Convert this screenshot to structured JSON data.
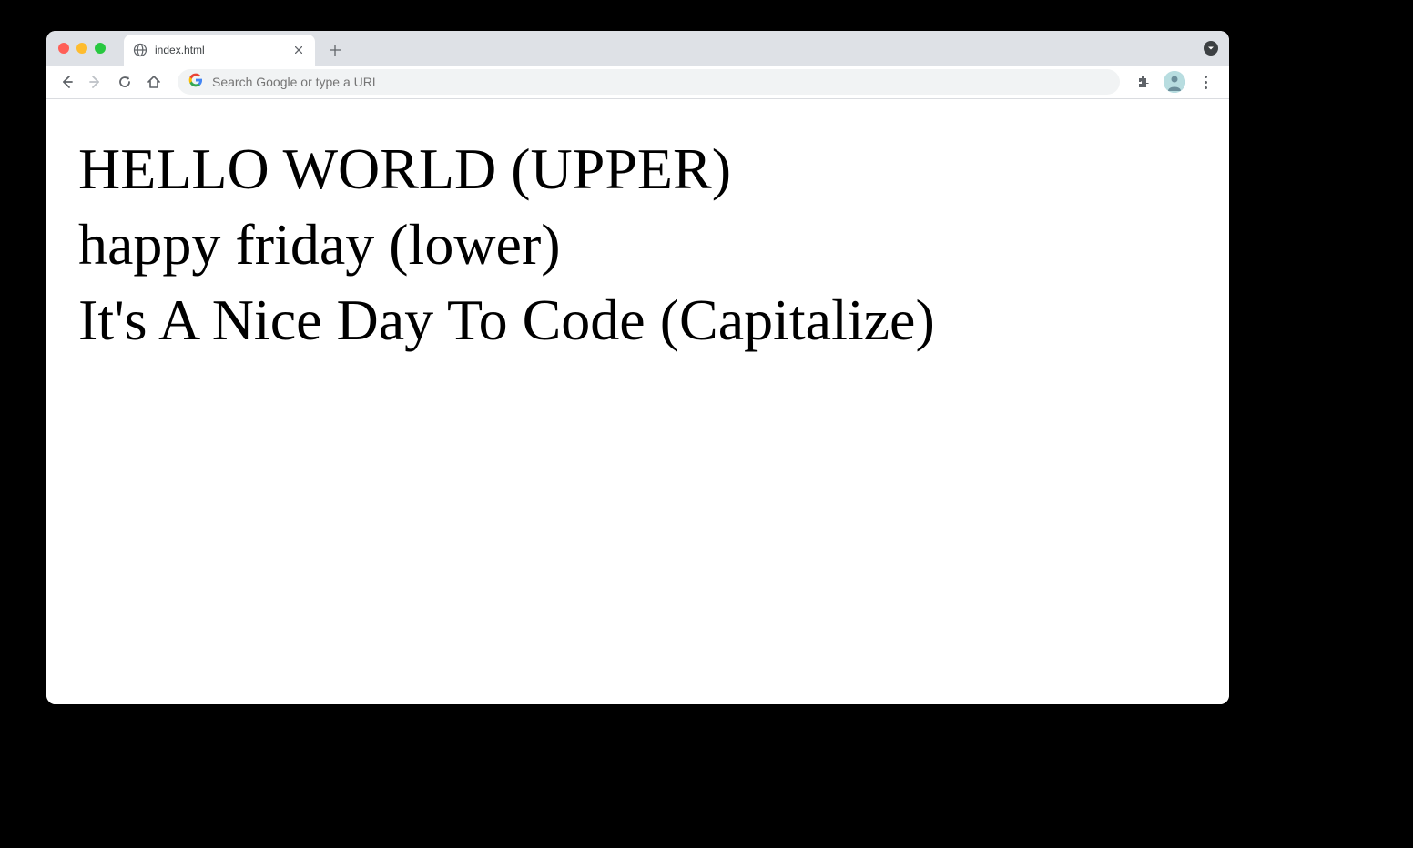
{
  "tab": {
    "title": "index.html"
  },
  "omnibox": {
    "placeholder": "Search Google or type a URL"
  },
  "content": {
    "line1": "HELLO WORLD (UPPER)",
    "line2": "happy friday (lower)",
    "line3": "It's A Nice Day To Code (Capitalize)"
  }
}
